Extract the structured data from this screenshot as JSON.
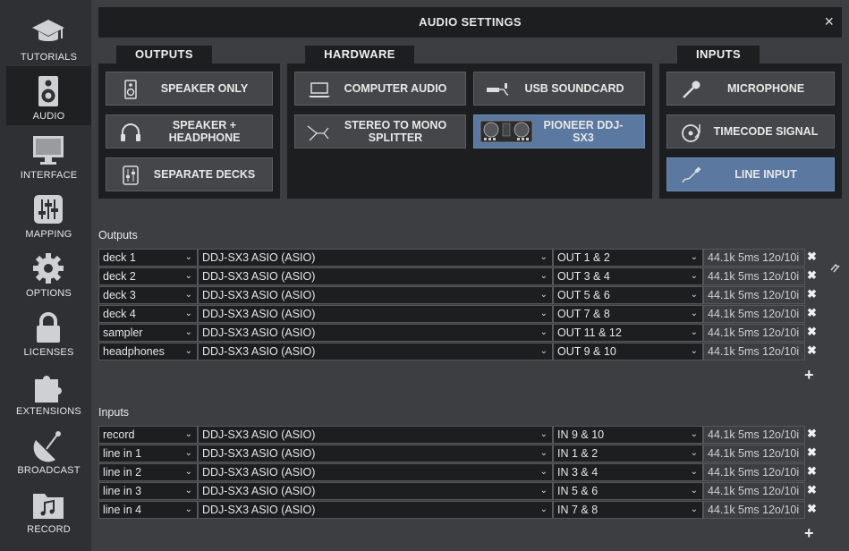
{
  "sidebar": {
    "items": [
      {
        "label": "TUTORIALS",
        "icon": "graduation-cap-icon"
      },
      {
        "label": "AUDIO",
        "icon": "speaker-icon",
        "active": true
      },
      {
        "label": "INTERFACE",
        "icon": "monitor-icon"
      },
      {
        "label": "MAPPING",
        "icon": "sliders-icon"
      },
      {
        "label": "OPTIONS",
        "icon": "gear-icon"
      },
      {
        "label": "LICENSES",
        "icon": "lock-icon"
      },
      {
        "label": "EXTENSIONS",
        "icon": "puzzle-icon"
      },
      {
        "label": "BROADCAST",
        "icon": "satellite-dish-icon"
      },
      {
        "label": "RECORD",
        "icon": "music-folder-icon"
      }
    ]
  },
  "window": {
    "title": "AUDIO SETTINGS",
    "close": "×"
  },
  "groups": {
    "outputs": {
      "title": "OUTPUTS",
      "buttons": [
        {
          "label": "SPEAKER ONLY",
          "icon": "speaker-icon"
        },
        {
          "label": "SPEAKER + HEADPHONE",
          "icon": "headphone-icon"
        },
        {
          "label": "SEPARATE DECKS",
          "icon": "mixer-icon"
        }
      ]
    },
    "hardware": {
      "title": "HARDWARE",
      "buttons": [
        {
          "label": "COMPUTER AUDIO",
          "icon": "laptop-icon"
        },
        {
          "label": "USB SOUNDCARD",
          "icon": "usb-soundcard-icon"
        },
        {
          "label": "STEREO TO MONO SPLITTER",
          "icon": "splitter-cable-icon"
        },
        {
          "label": "PIONEER DDJ-SX3",
          "icon": "controller-image",
          "selected": true
        }
      ]
    },
    "inputs": {
      "title": "INPUTS",
      "buttons": [
        {
          "label": "MICROPHONE",
          "icon": "microphone-icon"
        },
        {
          "label": "TIMECODE SIGNAL",
          "icon": "turntable-icon"
        },
        {
          "label": "LINE INPUT",
          "icon": "line-cable-icon",
          "selected": true
        }
      ]
    }
  },
  "outputs_table": {
    "label": "Outputs",
    "rows": [
      {
        "channel": "deck 1",
        "device": "DDJ-SX3 ASIO (ASIO)",
        "port": "OUT 1 & 2",
        "info": "44.1k 5ms 12o/10i"
      },
      {
        "channel": "deck 2",
        "device": "DDJ-SX3 ASIO (ASIO)",
        "port": "OUT 3 & 4",
        "info": "44.1k 5ms 12o/10i"
      },
      {
        "channel": "deck 3",
        "device": "DDJ-SX3 ASIO (ASIO)",
        "port": "OUT 5 & 6",
        "info": "44.1k 5ms 12o/10i"
      },
      {
        "channel": "deck 4",
        "device": "DDJ-SX3 ASIO (ASIO)",
        "port": "OUT 7 & 8",
        "info": "44.1k 5ms 12o/10i"
      },
      {
        "channel": "sampler",
        "device": "DDJ-SX3 ASIO (ASIO)",
        "port": "OUT 11 & 12",
        "info": "44.1k 5ms 12o/10i"
      },
      {
        "channel": "headphones",
        "device": "DDJ-SX3 ASIO (ASIO)",
        "port": "OUT 9 & 10",
        "info": "44.1k 5ms 12o/10i"
      }
    ]
  },
  "inputs_table": {
    "label": "Inputs",
    "rows": [
      {
        "channel": "record",
        "device": "DDJ-SX3 ASIO (ASIO)",
        "port": "IN 9 & 10",
        "info": "44.1k 5ms 12o/10i"
      },
      {
        "channel": "line in 1",
        "device": "DDJ-SX3 ASIO (ASIO)",
        "port": "IN 1 & 2",
        "info": "44.1k 5ms 12o/10i"
      },
      {
        "channel": "line in 2",
        "device": "DDJ-SX3 ASIO (ASIO)",
        "port": "IN 3 & 4",
        "info": "44.1k 5ms 12o/10i"
      },
      {
        "channel": "line in 3",
        "device": "DDJ-SX3 ASIO (ASIO)",
        "port": "IN 5 & 6",
        "info": "44.1k 5ms 12o/10i"
      },
      {
        "channel": "line in 4",
        "device": "DDJ-SX3 ASIO (ASIO)",
        "port": "IN 7 & 8",
        "info": "44.1k 5ms 12o/10i"
      }
    ]
  },
  "glyphs": {
    "remove": "✖",
    "add": "+",
    "dropdown": "⌄"
  },
  "colors": {
    "selected": "#5a78a0",
    "panel": "#1d1e20",
    "background": "#3d3e42"
  }
}
